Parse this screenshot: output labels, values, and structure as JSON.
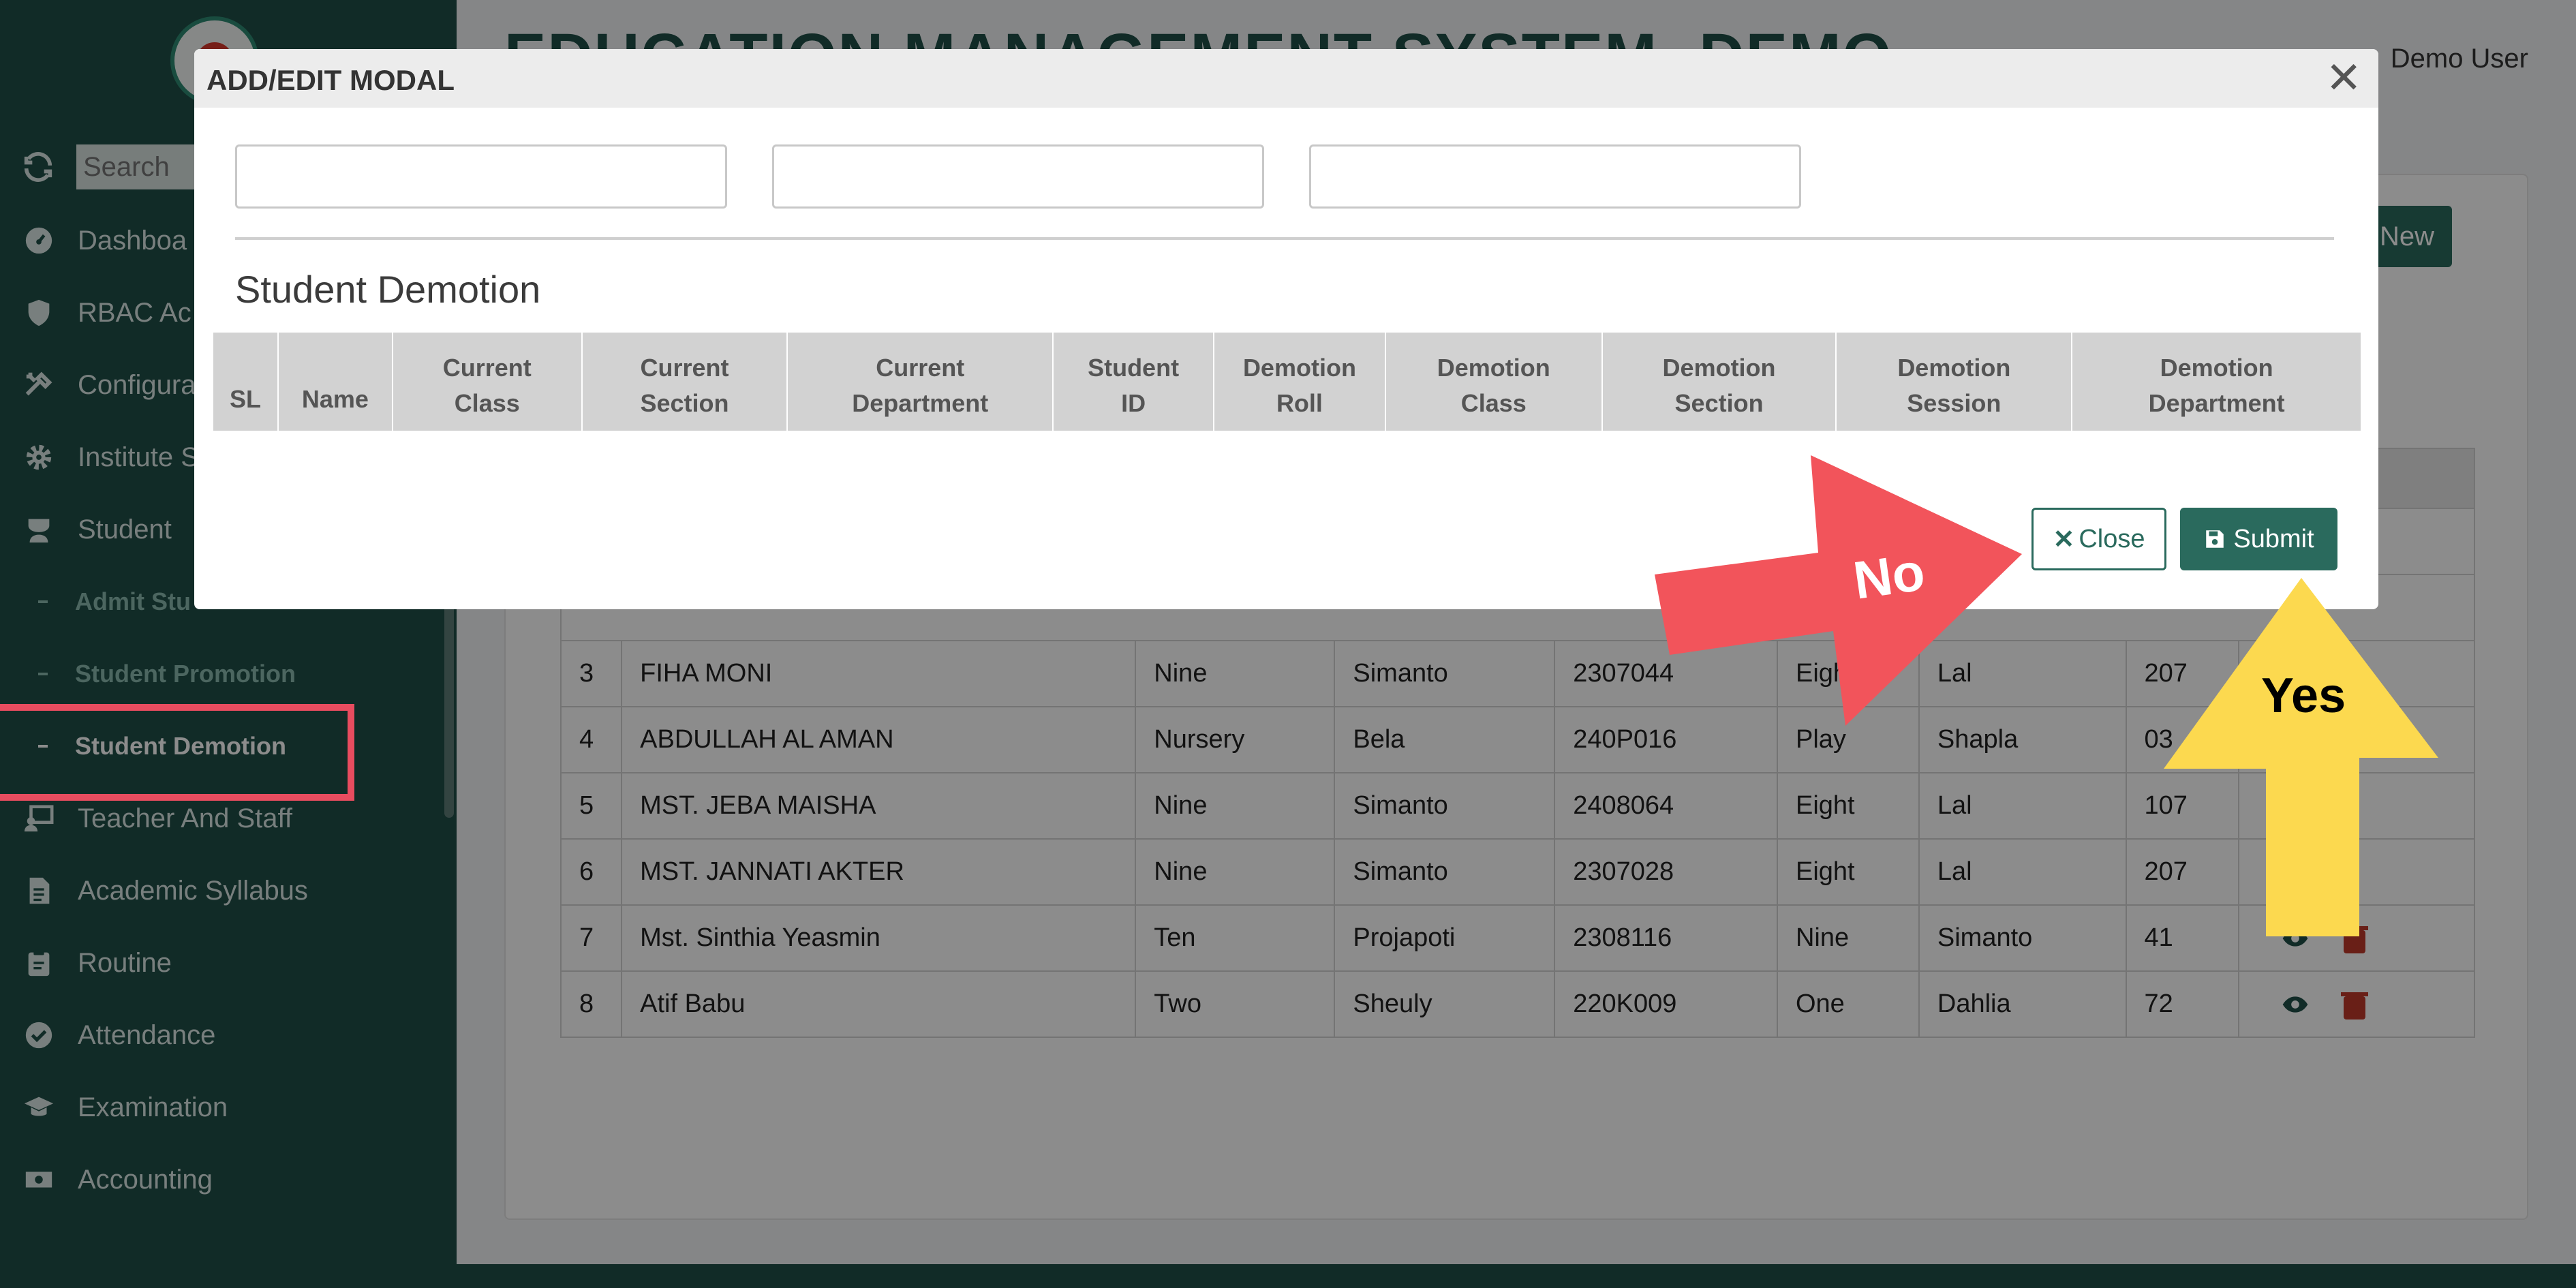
{
  "app": {
    "title": "EDUCATION MANAGEMENT SYSTEM- DEMO",
    "user": "Demo User",
    "add_new": "New"
  },
  "sidebar": {
    "search_placeholder": "Search",
    "items": [
      {
        "label": "Dashboa",
        "icon": "dashboard-icon"
      },
      {
        "label": "RBAC Ac",
        "icon": "shield-icon"
      },
      {
        "label": "Configura",
        "icon": "tools-icon"
      },
      {
        "label": "Institute S",
        "icon": "gear-icon"
      },
      {
        "label": "Student",
        "icon": "student-icon"
      }
    ],
    "sub_items": [
      {
        "label": "Admit Stu"
      },
      {
        "label": "Student Promotion"
      },
      {
        "label": "Student Demotion",
        "active": true
      }
    ],
    "items2": [
      {
        "label": "Teacher And Staff",
        "icon": "teacher-icon"
      },
      {
        "label": "Academic Syllabus",
        "icon": "document-icon"
      },
      {
        "label": "Routine",
        "icon": "clipboard-icon"
      },
      {
        "label": "Attendance",
        "icon": "check-circle-icon"
      },
      {
        "label": "Examination",
        "icon": "graduation-cap-icon"
      },
      {
        "label": "Accounting",
        "icon": "money-icon"
      }
    ]
  },
  "list_table": {
    "rows": [
      {
        "sl": "3",
        "name": "FIHA MONI",
        "c1": "Nine",
        "c2": "Simanto",
        "id": "2307044",
        "c3": "Eight",
        "c4": "Lal",
        "roll": "207"
      },
      {
        "sl": "4",
        "name": "ABDULLAH AL AMAN",
        "c1": "Nursery",
        "c2": "Bela",
        "id": "240P016",
        "c3": "Play",
        "c4": "Shapla",
        "roll": "03"
      },
      {
        "sl": "5",
        "name": "MST. JEBA MAISHA",
        "c1": "Nine",
        "c2": "Simanto",
        "id": "2408064",
        "c3": "Eight",
        "c4": "Lal",
        "roll": "107"
      },
      {
        "sl": "6",
        "name": "MST. JANNATI AKTER",
        "c1": "Nine",
        "c2": "Simanto",
        "id": "2307028",
        "c3": "Eight",
        "c4": "Lal",
        "roll": "207"
      },
      {
        "sl": "7",
        "name": "Mst. Sinthia Yeasmin",
        "c1": "Ten",
        "c2": "Projapoti",
        "id": "2308116",
        "c3": "Nine",
        "c4": "Simanto",
        "roll": "41"
      },
      {
        "sl": "8",
        "name": "Atif Babu",
        "c1": "Two",
        "c2": "Sheuly",
        "id": "220K009",
        "c3": "One",
        "c4": "Dahlia",
        "roll": "72"
      }
    ]
  },
  "modal": {
    "title": "ADD/EDIT MODAL",
    "close_glyph": "✕",
    "section_title": "Student Demotion",
    "inputs": [
      "",
      "",
      ""
    ],
    "columns": [
      {
        "l1": "",
        "l2": "SL"
      },
      {
        "l1": "",
        "l2": "Name"
      },
      {
        "l1": "Current",
        "l2": "Class"
      },
      {
        "l1": "Current",
        "l2": "Section"
      },
      {
        "l1": "Current",
        "l2": "Department"
      },
      {
        "l1": "Student",
        "l2": "ID"
      },
      {
        "l1": "Demotion",
        "l2": "Roll"
      },
      {
        "l1": "Demotion",
        "l2": "Class"
      },
      {
        "l1": "Demotion",
        "l2": "Section"
      },
      {
        "l1": "Demotion",
        "l2": "Session"
      },
      {
        "l1": "Demotion",
        "l2": "Department"
      }
    ],
    "close_btn": "Close",
    "submit_btn": "Submit"
  },
  "annotations": {
    "no_label": "No",
    "yes_label": "Yes",
    "no_color": "#f2545b",
    "yes_color": "#fcd94f",
    "highlight_color": "#e84c5f"
  },
  "colors": {
    "sidebar_bg": "#1f4f47",
    "primary": "#2a6a5d",
    "delete_icon": "#c0392b"
  }
}
